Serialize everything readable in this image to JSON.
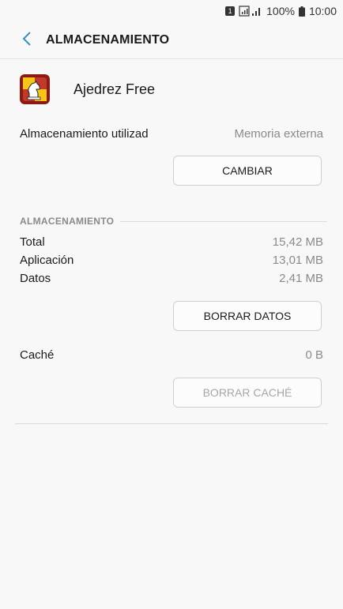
{
  "status_bar": {
    "sim_label": "1",
    "battery_text": "100%",
    "time": "10:00"
  },
  "app_bar": {
    "title": "ALMACENAMIENTO",
    "back_icon": "chevron-left-icon"
  },
  "app": {
    "name": "Ajedrez Free",
    "icon": "chess-app-icon"
  },
  "storage_used": {
    "label": "Almacenamiento utilizad",
    "value": "Memoria externa",
    "button": "CAMBIAR"
  },
  "storage_section": {
    "header": "ALMACENAMIENTO",
    "rows": [
      {
        "label": "Total",
        "value": "15,42 MB"
      },
      {
        "label": "Aplicación",
        "value": "13,01 MB"
      },
      {
        "label": "Datos",
        "value": "2,41 MB"
      }
    ],
    "clear_data_button": "BORRAR DATOS"
  },
  "cache": {
    "label": "Caché",
    "value": "0 B",
    "clear_cache_button": "BORRAR CACHÉ"
  },
  "colors": {
    "accent": "#3a8fbf",
    "muted_text": "#8a8a8a",
    "background": "#f8f8f8"
  }
}
